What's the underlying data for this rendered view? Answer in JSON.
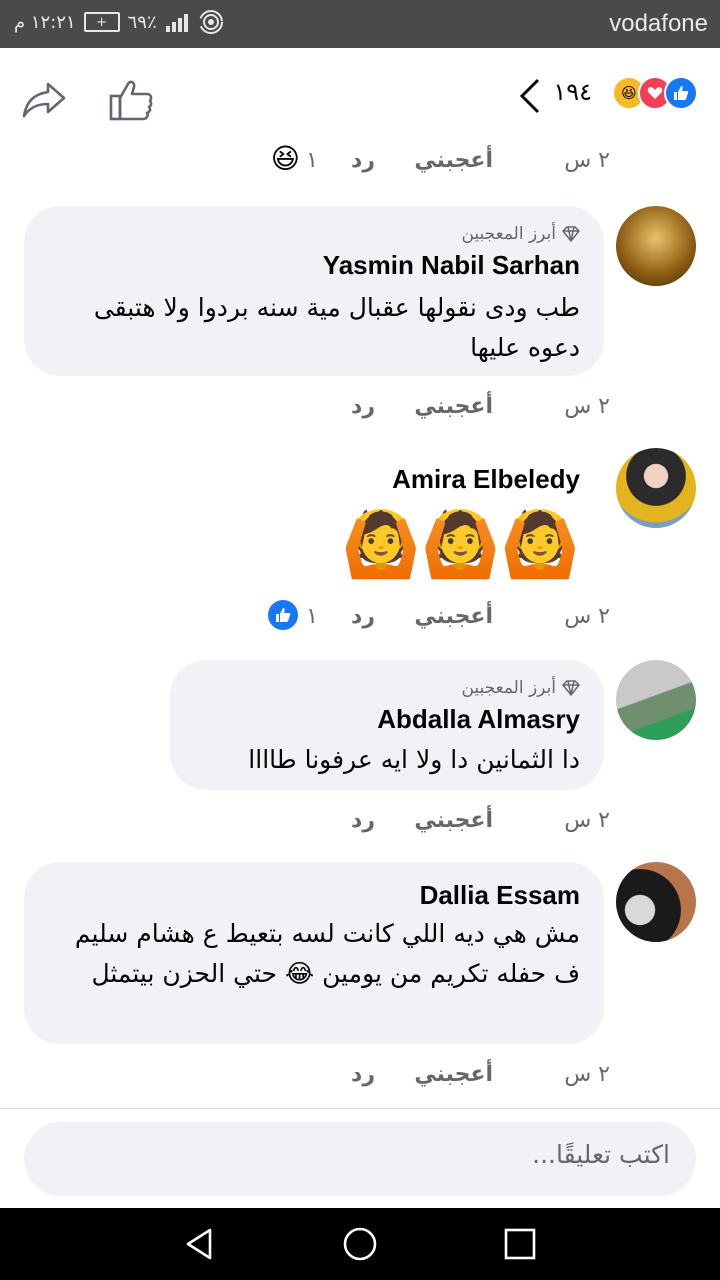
{
  "status_bar": {
    "carrier": "vodafone",
    "time": "١٢:٢١ م",
    "battery": "٦٩٪"
  },
  "header": {
    "reaction_count": "١٩٤",
    "reaction_icons": [
      "like-icon",
      "love-icon",
      "haha-icon"
    ]
  },
  "labels": {
    "like": "أعجبني",
    "reply": "رد",
    "time": "٢ س",
    "top_fan": "أبرز المعجبين"
  },
  "top_comment": {
    "reaction_count": "١"
  },
  "comments": [
    {
      "name": "Yasmin Nabil Sarhan",
      "top_fan": true,
      "text": "طب ودى نقولها عقبال مية سنه بردوا ولا هتبقى دعوه عليها"
    },
    {
      "name": "Amira Elbeledy",
      "top_fan": false,
      "text": "🙆🙆🙆",
      "reaction_count": "١"
    },
    {
      "name": "Abdalla Almasry",
      "top_fan": true,
      "text": "دا الثمانين دا ولا ايه عرفونا طاااا"
    },
    {
      "name": "Dallia Essam",
      "top_fan": false,
      "text": "مش هي ديه اللي كانت لسه بتعيط ع هشام سليم ف حفله تكريم من يومين 😂 حتي الحزن بيتمثل"
    }
  ],
  "composer": {
    "placeholder": "اكتب تعليقًا..."
  },
  "colors": {
    "status_bar": "#4a4a4a",
    "bubble": "#f0f2f5",
    "like_blue": "#1877f2",
    "love_red": "#f33e58",
    "haha_yellow": "#f7b928"
  }
}
